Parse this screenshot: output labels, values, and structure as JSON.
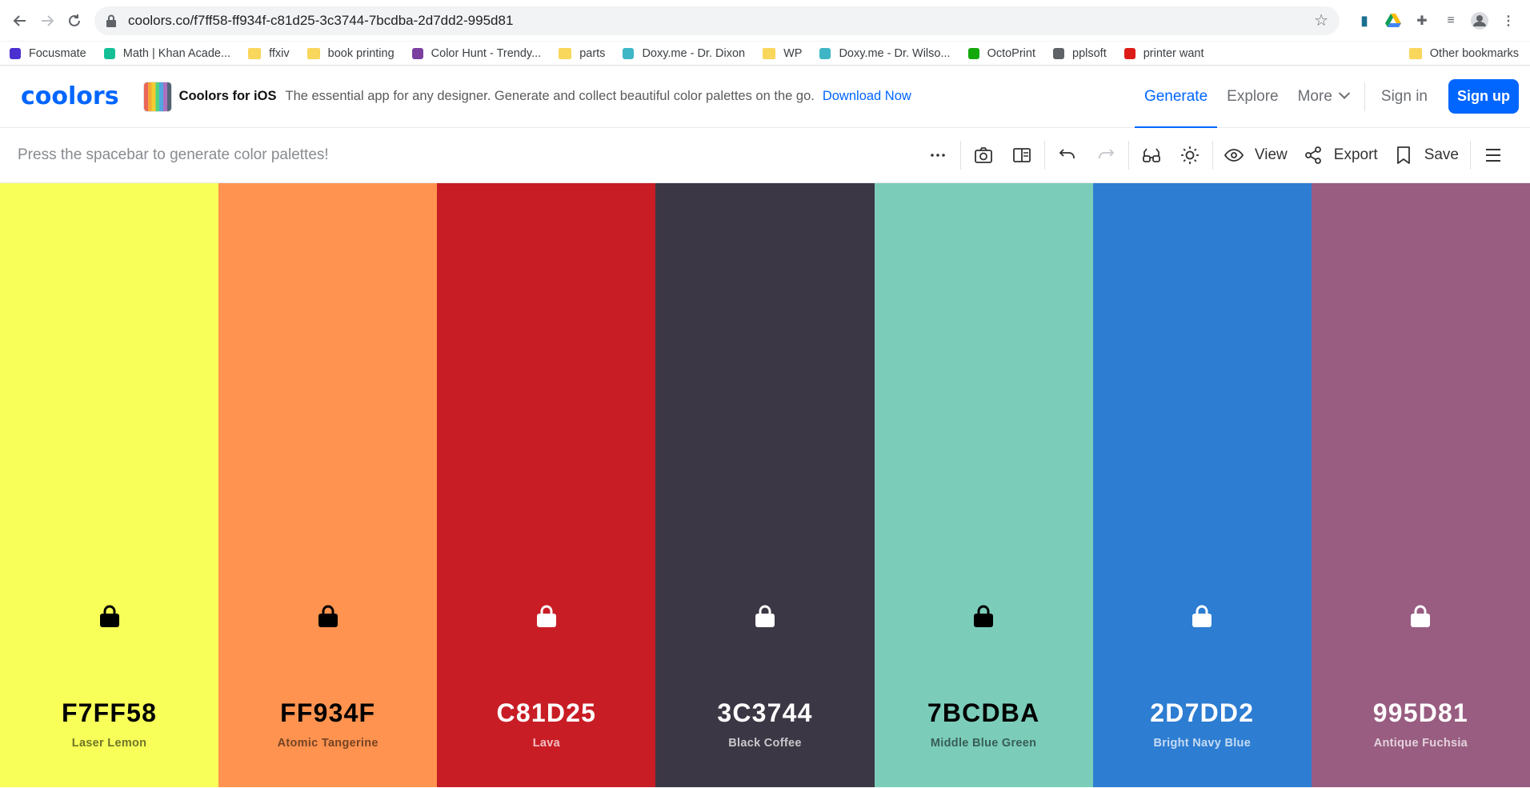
{
  "browser": {
    "url": "coolors.co/f7ff58-ff934f-c81d25-3c3744-7bcdba-2d7dd2-995d81",
    "bookmarks": [
      {
        "label": "Focusmate",
        "color": "#4b2fd1",
        "kind": "site"
      },
      {
        "label": "Math | Khan Acade...",
        "color": "#14bf96",
        "kind": "site"
      },
      {
        "label": "ffxiv",
        "color": "#f9d65c",
        "kind": "folder"
      },
      {
        "label": "book printing",
        "color": "#f9d65c",
        "kind": "folder"
      },
      {
        "label": "Color Hunt - Trendy...",
        "color": "#7b3fa0",
        "kind": "site"
      },
      {
        "label": "parts",
        "color": "#f9d65c",
        "kind": "folder"
      },
      {
        "label": "Doxy.me - Dr. Dixon",
        "color": "#3fb6c5",
        "kind": "site"
      },
      {
        "label": "WP",
        "color": "#f9d65c",
        "kind": "folder"
      },
      {
        "label": "Doxy.me - Dr. Wilso...",
        "color": "#3fb6c5",
        "kind": "site"
      },
      {
        "label": "OctoPrint",
        "color": "#13a90b",
        "kind": "site"
      },
      {
        "label": "pplsoft",
        "color": "#5f6368",
        "kind": "site"
      },
      {
        "label": "printer want",
        "color": "#dd1b16",
        "kind": "site"
      }
    ],
    "other_bookmarks": "Other bookmarks"
  },
  "header": {
    "logo": "coolors",
    "ios_title": "Coolors for iOS",
    "ios_desc": "The essential app for any designer. Generate and collect beautiful color palettes on the go.",
    "ios_link": "Download Now",
    "nav_generate": "Generate",
    "nav_explore": "Explore",
    "nav_more": "More",
    "sign_in": "Sign in",
    "sign_up": "Sign up",
    "accent": "#0066ff"
  },
  "toolbar": {
    "hint": "Press the spacebar to generate color palettes!",
    "view_label": "View",
    "export_label": "Export",
    "save_label": "Save"
  },
  "palette": [
    {
      "hex": "F7FF58",
      "name": "Laser Lemon",
      "color": "#f7ff58",
      "text_dark": true
    },
    {
      "hex": "FF934F",
      "name": "Atomic Tangerine",
      "color": "#ff934f",
      "text_dark": true
    },
    {
      "hex": "C81D25",
      "name": "Lava",
      "color": "#c81d25",
      "text_dark": false
    },
    {
      "hex": "3C3744",
      "name": "Black Coffee",
      "color": "#3c3744",
      "text_dark": false
    },
    {
      "hex": "7BCDBA",
      "name": "Middle Blue Green",
      "color": "#7bcdba",
      "text_dark": true
    },
    {
      "hex": "2D7DD2",
      "name": "Bright Navy Blue",
      "color": "#2d7dd2",
      "text_dark": false
    },
    {
      "hex": "995D81",
      "name": "Antique Fuchsia",
      "color": "#995d81",
      "text_dark": false
    }
  ]
}
